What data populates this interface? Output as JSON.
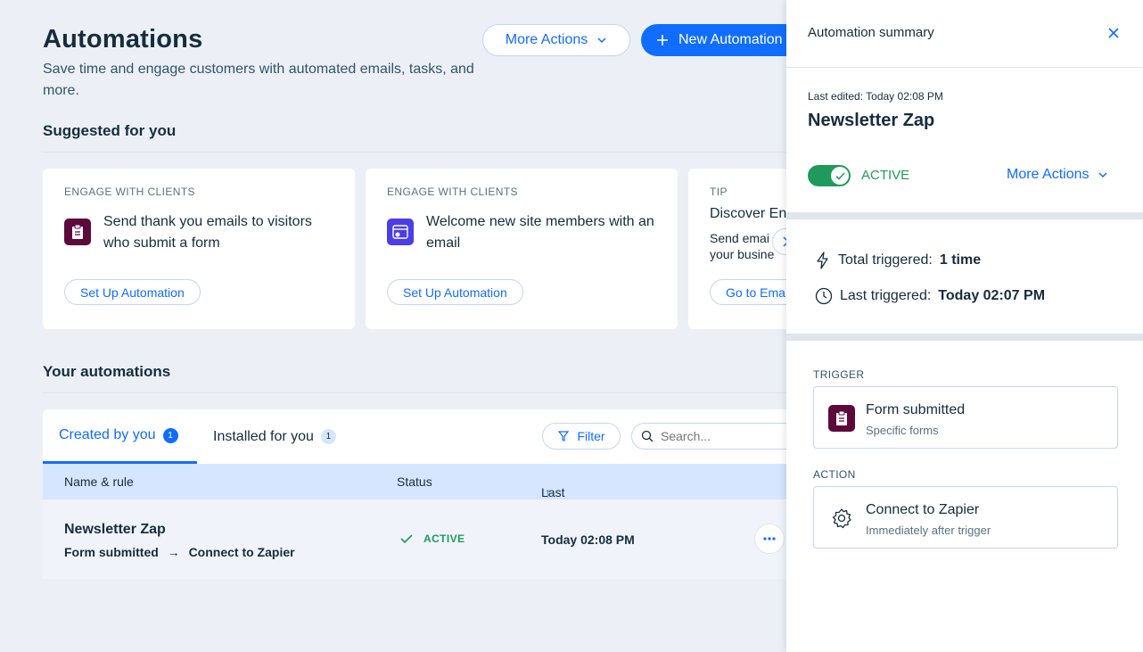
{
  "page": {
    "title": "Automations",
    "subtitle": "Save time and engage customers with automated emails, tasks, and more.",
    "more_actions": "More Actions",
    "new_automation": "New Automation"
  },
  "suggested": {
    "title": "Suggested for you",
    "cards": [
      {
        "eyebrow": "ENGAGE WITH CLIENTS",
        "text": "Send thank you emails to visitors who submit a form",
        "button": "Set Up Automation",
        "icon": "clipboard-icon",
        "icon_color": "#5c0a3c"
      },
      {
        "eyebrow": "ENGAGE WITH CLIENTS",
        "text": "Welcome new site members with an email",
        "button": "Set Up Automation",
        "icon": "member-window-icon",
        "icon_color": "#4b3ee6"
      },
      {
        "eyebrow": "TIP",
        "title": "Discover En",
        "text_line1": "Send emai",
        "text_line2": "your busine",
        "button": "Go to Ema"
      }
    ]
  },
  "automations": {
    "title": "Your automations",
    "tabs": [
      {
        "label": "Created by you",
        "count": "1"
      },
      {
        "label": "Installed for you",
        "count": "1"
      }
    ],
    "filter": "Filter",
    "search_placeholder": "Search...",
    "columns": {
      "name": "Name & rule",
      "status": "Status",
      "last_edited": "Last edited",
      "sort_arrow": "↑"
    },
    "rows": [
      {
        "name": "Newsletter Zap",
        "trigger": "Form submitted",
        "arrow": "→",
        "action": "Connect to Zapier",
        "status": "ACTIVE",
        "last_edited": "Today 02:08 PM"
      }
    ]
  },
  "summary": {
    "header": "Automation summary",
    "last_edited": "Last edited: Today 02:08 PM",
    "name": "Newsletter Zap",
    "status": "ACTIVE",
    "more_actions": "More Actions",
    "total_triggered_label": "Total triggered:",
    "total_triggered_value": "1 time",
    "last_triggered_label": "Last triggered:",
    "last_triggered_value": "Today 02:07 PM",
    "trigger_eyebrow": "TRIGGER",
    "trigger_title": "Form submitted",
    "trigger_sub": "Specific forms",
    "action_eyebrow": "ACTION",
    "action_title": "Connect to Zapier",
    "action_sub": "Immediately after trigger"
  },
  "colors": {
    "accent": "#116dff",
    "active_green": "#1e9b5a",
    "header_blue": "#d6e6fe",
    "text_dark": "#162d3d"
  }
}
